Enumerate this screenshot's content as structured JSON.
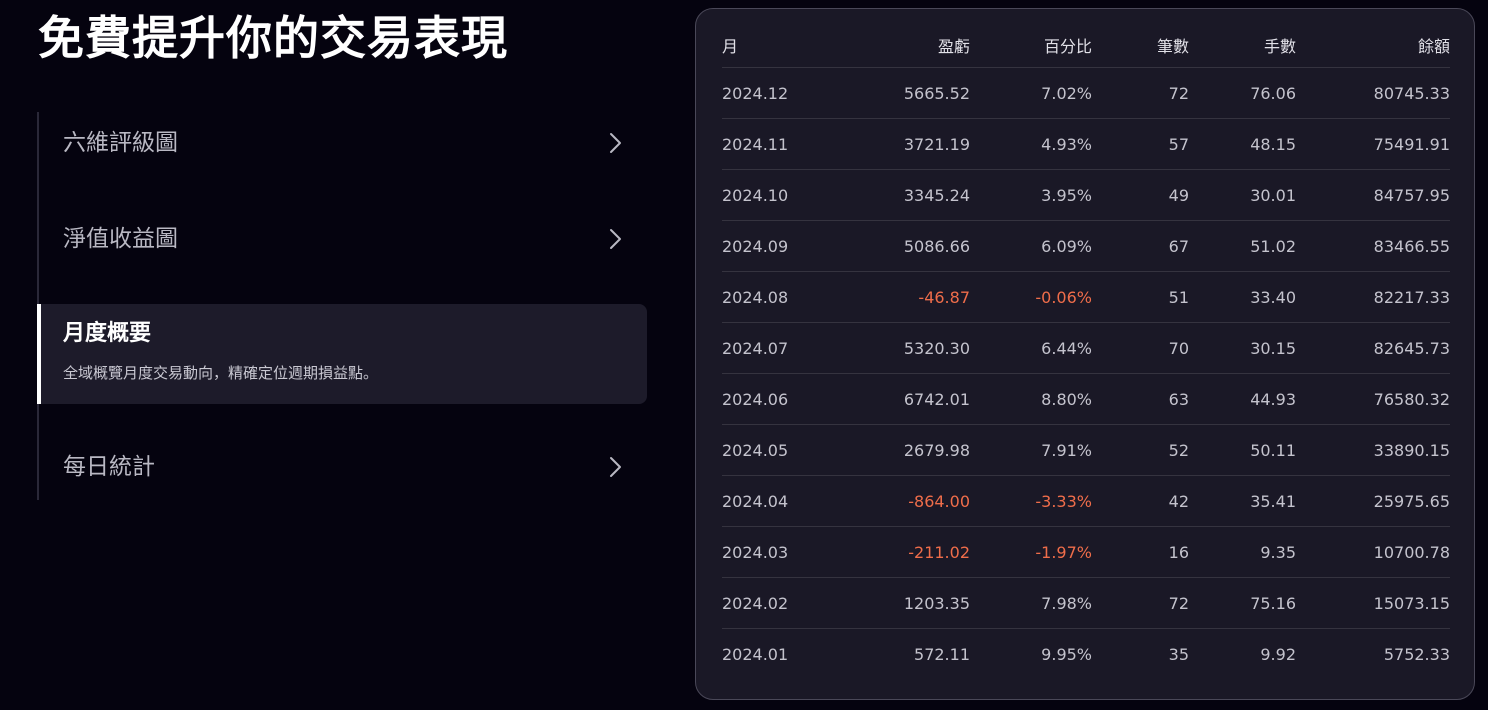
{
  "page": {
    "title": "免費提升你的交易表現"
  },
  "nav": {
    "items": [
      {
        "label": "六維評級圖"
      },
      {
        "label": "淨值收益圖"
      },
      {
        "label": "月度概要",
        "description": "全域概覽月度交易動向，精確定位週期損益點。",
        "active": true
      },
      {
        "label": "每日統計"
      }
    ]
  },
  "table": {
    "headers": {
      "month": "月",
      "pnl": "盈虧",
      "percent": "百分比",
      "trades": "筆數",
      "lots": "手數",
      "balance": "餘額"
    },
    "rows": [
      {
        "month": "2024.12",
        "pnl": "5665.52",
        "percent": "7.02%",
        "trades": "72",
        "lots": "76.06",
        "balance": "80745.33"
      },
      {
        "month": "2024.11",
        "pnl": "3721.19",
        "percent": "4.93%",
        "trades": "57",
        "lots": "48.15",
        "balance": "75491.91"
      },
      {
        "month": "2024.10",
        "pnl": "3345.24",
        "percent": "3.95%",
        "trades": "49",
        "lots": "30.01",
        "balance": "84757.95"
      },
      {
        "month": "2024.09",
        "pnl": "5086.66",
        "percent": "6.09%",
        "trades": "67",
        "lots": "51.02",
        "balance": "83466.55"
      },
      {
        "month": "2024.08",
        "pnl": "-46.87",
        "percent": "-0.06%",
        "trades": "51",
        "lots": "33.40",
        "balance": "82217.33"
      },
      {
        "month": "2024.07",
        "pnl": "5320.30",
        "percent": "6.44%",
        "trades": "70",
        "lots": "30.15",
        "balance": "82645.73"
      },
      {
        "month": "2024.06",
        "pnl": "6742.01",
        "percent": "8.80%",
        "trades": "63",
        "lots": "44.93",
        "balance": "76580.32"
      },
      {
        "month": "2024.05",
        "pnl": "2679.98",
        "percent": "7.91%",
        "trades": "52",
        "lots": "50.11",
        "balance": "33890.15"
      },
      {
        "month": "2024.04",
        "pnl": "-864.00",
        "percent": "-3.33%",
        "trades": "42",
        "lots": "35.41",
        "balance": "25975.65"
      },
      {
        "month": "2024.03",
        "pnl": "-211.02",
        "percent": "-1.97%",
        "trades": "16",
        "lots": "9.35",
        "balance": "10700.78"
      },
      {
        "month": "2024.02",
        "pnl": "1203.35",
        "percent": "7.98%",
        "trades": "72",
        "lots": "75.16",
        "balance": "15073.15"
      },
      {
        "month": "2024.01",
        "pnl": "572.11",
        "percent": "9.95%",
        "trades": "35",
        "lots": "9.92",
        "balance": "5752.33"
      }
    ]
  },
  "colors": {
    "background": "#05030f",
    "card": "#1a1826",
    "negative": "#ef6d4a",
    "text": "#c4c3cd"
  },
  "icons": {
    "nav_chevron": "chevron-right-icon"
  }
}
